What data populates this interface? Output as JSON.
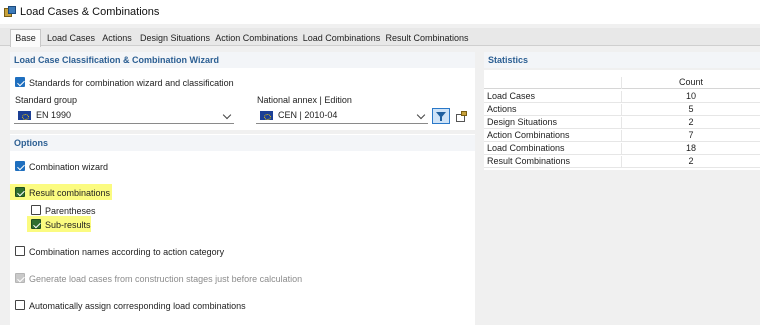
{
  "window": {
    "title": "Load Cases & Combinations"
  },
  "tabs": [
    {
      "label": "Base",
      "active": true
    },
    {
      "label": "Load Cases"
    },
    {
      "label": "Actions"
    },
    {
      "label": "Design Situations"
    },
    {
      "label": "Action Combinations"
    },
    {
      "label": "Load Combinations"
    },
    {
      "label": "Result Combinations"
    }
  ],
  "classification": {
    "header": "Load Case Classification & Combination Wizard",
    "standards_checkbox": {
      "label": "Standards for combination wizard and classification",
      "checked": true
    },
    "standard_group": {
      "label": "Standard group",
      "value": "EN 1990"
    },
    "national_annex": {
      "label": "National annex | Edition",
      "value": "CEN | 2010-04"
    }
  },
  "options": {
    "header": "Options",
    "combination_wizard": {
      "label": "Combination wizard",
      "checked": true
    },
    "result_combinations": {
      "label": "Result combinations",
      "checked": true,
      "highlighted": true
    },
    "parentheses": {
      "label": "Parentheses",
      "checked": false
    },
    "sub_results": {
      "label": "Sub-results",
      "checked": true,
      "highlighted": true
    },
    "combination_names": {
      "label": "Combination names according to action category",
      "checked": false
    },
    "generate_load_cases": {
      "label": "Generate load cases from construction stages just before calculation",
      "checked": true,
      "disabled": true
    },
    "auto_assign": {
      "label": "Automatically assign corresponding load combinations",
      "checked": false
    }
  },
  "statistics": {
    "header": "Statistics",
    "column_header": "Count",
    "rows": [
      {
        "name": "Load Cases",
        "count": "10"
      },
      {
        "name": "Actions",
        "count": "5"
      },
      {
        "name": "Design Situations",
        "count": "2"
      },
      {
        "name": "Action Combinations",
        "count": "7"
      },
      {
        "name": "Load Combinations",
        "count": "18"
      },
      {
        "name": "Result Combinations",
        "count": "2"
      }
    ]
  },
  "colors": {
    "accent": "#1f6fbf",
    "header_text": "#2c5f93",
    "highlight": "#fbfb80"
  }
}
